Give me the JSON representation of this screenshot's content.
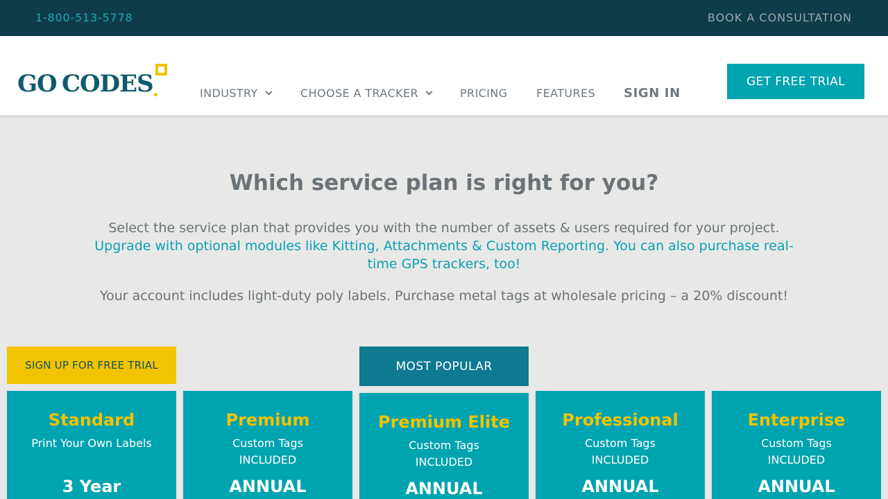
{
  "topbar": {
    "phone": "1-800-513-5778",
    "consultation": "BOOK A CONSULTATION"
  },
  "logo": {
    "go": "GO",
    "codes": "CODES"
  },
  "nav": {
    "industry": "INDUSTRY",
    "choose_tracker": "CHOOSE A TRACKER",
    "pricing": "PRICING",
    "features": "FEATURES",
    "sign_in": "SIGN IN",
    "free_trial": "GET FREE TRIAL"
  },
  "intro": {
    "heading": "Which service plan is right for you?",
    "line1": "Select the service plan that provides you with the number of assets & users required for your project.",
    "line2": "Upgrade with optional modules like Kitting, Attachments & Custom Reporting. You can also purchase real-time GPS trackers, too!",
    "line3": "Your account includes light-duty poly labels. Purchase metal tags at wholesale pricing – a 20% discount!"
  },
  "badges": {
    "signup": "SIGN UP FOR FREE TRIAL",
    "popular": "MOST POPULAR"
  },
  "plans": [
    {
      "name": "Standard",
      "sub": "Print Your Own Labels",
      "term": "3 Year"
    },
    {
      "name": "Premium",
      "sub": "Custom Tags INCLUDED",
      "term": "ANNUAL"
    },
    {
      "name": "Premium Elite",
      "sub": "Custom Tags INCLUDED",
      "term": "ANNUAL"
    },
    {
      "name": "Professional",
      "sub": "Custom Tags INCLUDED",
      "term": "ANNUAL"
    },
    {
      "name": "Enterprise",
      "sub": "Custom Tags INCLUDED",
      "term": "ANNUAL"
    }
  ],
  "colors": {
    "topbar": "#0f3c4b",
    "teal": "#00a3b0",
    "yellow": "#f2c300",
    "popular": "#0d7a8f"
  }
}
